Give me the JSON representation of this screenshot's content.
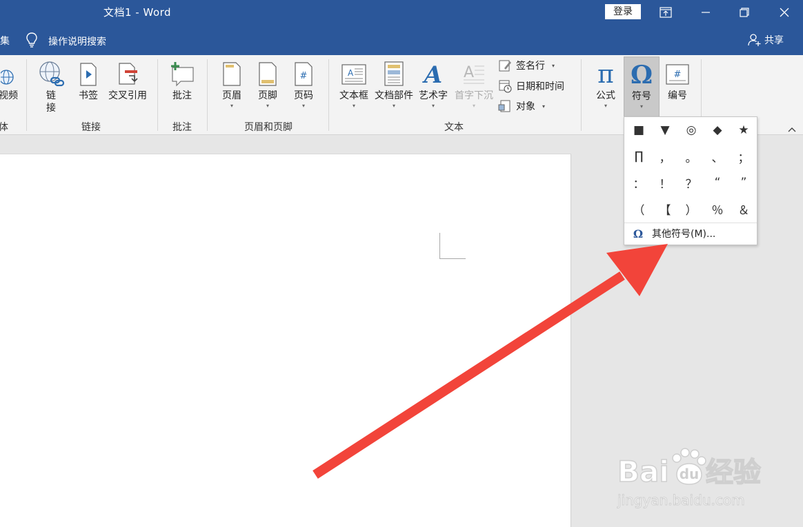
{
  "title_bar": {
    "doc_title": "文档1  -  Word",
    "login_label": "登录"
  },
  "tell_bar": {
    "cut_text": "集",
    "tell_me_label": "操作说明搜索",
    "share_label": "共享"
  },
  "ribbon": {
    "video_label": "视频",
    "media_group_cut": "体",
    "link_label": "链",
    "link_label_2": "接",
    "bookmark_label": "书签",
    "crossref_label": "交叉引用",
    "links_group": "链接",
    "comment_label": "批注",
    "comment_group": "批注",
    "header_label": "页眉",
    "footer_label": "页脚",
    "pagenum_label": "页码",
    "hf_group": "页眉和页脚",
    "textbox_label": "文本框",
    "docparts_label": "文档部件",
    "wordart_label": "艺术字",
    "dropcap_label": "首字下沉",
    "signature_label": "签名行",
    "datetime_label": "日期和时间",
    "object_label": "对象",
    "text_group": "文本",
    "equation_label": "公式",
    "symbol_label": "符号",
    "number_label": "编号"
  },
  "symbol_menu": {
    "symbols": [
      "■",
      "▼",
      "◎",
      "◆",
      "★",
      "∏",
      "，",
      "。",
      "、",
      "；",
      "：",
      "！",
      "？",
      "“",
      "”",
      "（",
      "【",
      "）",
      "％",
      "＆"
    ],
    "more_label": "其他符号(M)..."
  },
  "watermark": {
    "brand": "Bai du 经验",
    "url": "jingyan.baidu.com"
  },
  "colors": {
    "title_bar": "#2b579a",
    "ribbon": "#f3f3f3",
    "arrow": "#f2443a"
  }
}
